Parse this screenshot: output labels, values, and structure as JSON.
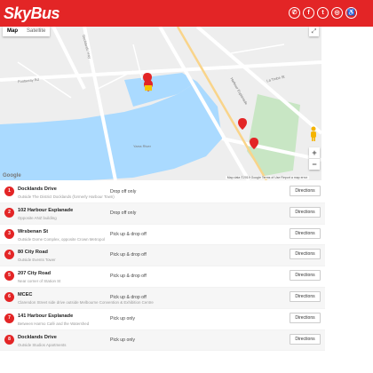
{
  "header": {
    "logo": "SkyBus",
    "social": [
      {
        "icon": "phone-icon",
        "glyph": "✆"
      },
      {
        "icon": "facebook-icon",
        "glyph": "f"
      },
      {
        "icon": "twitter-icon",
        "glyph": "t"
      },
      {
        "icon": "instagram-icon",
        "glyph": "◎"
      },
      {
        "icon": "accessibility-icon",
        "glyph": "♿"
      }
    ]
  },
  "map": {
    "type_map": "Map",
    "type_satellite": "Satellite",
    "zoom_in": "+",
    "zoom_out": "−",
    "google": "Google",
    "attribution": "Map data ©2019 Google   Terms of Use   Report a map error",
    "streets": [
      "Yarra River",
      "La Trobe St",
      "Docklands Hwy",
      "Harbour Esplanade",
      "Footscray Rd"
    ],
    "colors": {
      "water": "#aadaff",
      "park": "#c8e6c4",
      "land": "#eeeeee",
      "road": "#ffffff",
      "marker": "#e32526"
    }
  },
  "stops": [
    {
      "num": "1",
      "name": "Docklands Drive",
      "desc": "Outside The District Docklands (formerly Harbour Town)",
      "type": "Drop off only",
      "button": "Directions"
    },
    {
      "num": "2",
      "name": "102 Harbour Esplanade",
      "desc": "Opposite ANZ building",
      "type": "Drop off only",
      "button": "Directions"
    },
    {
      "num": "3",
      "name": "Wrsbenan St",
      "desc": "Outside Dome Complex, opposite Crown Metropol",
      "type": "Pick up & drop off",
      "button": "Directions"
    },
    {
      "num": "4",
      "name": "80 City Road",
      "desc": "Outside Events Tower",
      "type": "Pick up & drop off",
      "button": "Directions"
    },
    {
      "num": "5",
      "name": "207 City Road",
      "desc": "Near corner of Station St",
      "type": "Pick up & drop off",
      "button": "Directions"
    },
    {
      "num": "6",
      "name": "MCEC",
      "desc": "Clarendon Street side drive outside Melbourne Convention & Exhibition Centre",
      "type": "Pick up & drop off",
      "button": "Directions"
    },
    {
      "num": "7",
      "name": "141 Harbour Esplanade",
      "desc": "Between Harmo Café and the Watershed",
      "type": "Pick up only",
      "button": "Directions"
    },
    {
      "num": "8",
      "name": "Docklands Drive",
      "desc": "Outside Studios Apartments",
      "type": "Pick up only",
      "button": "Directions"
    }
  ]
}
